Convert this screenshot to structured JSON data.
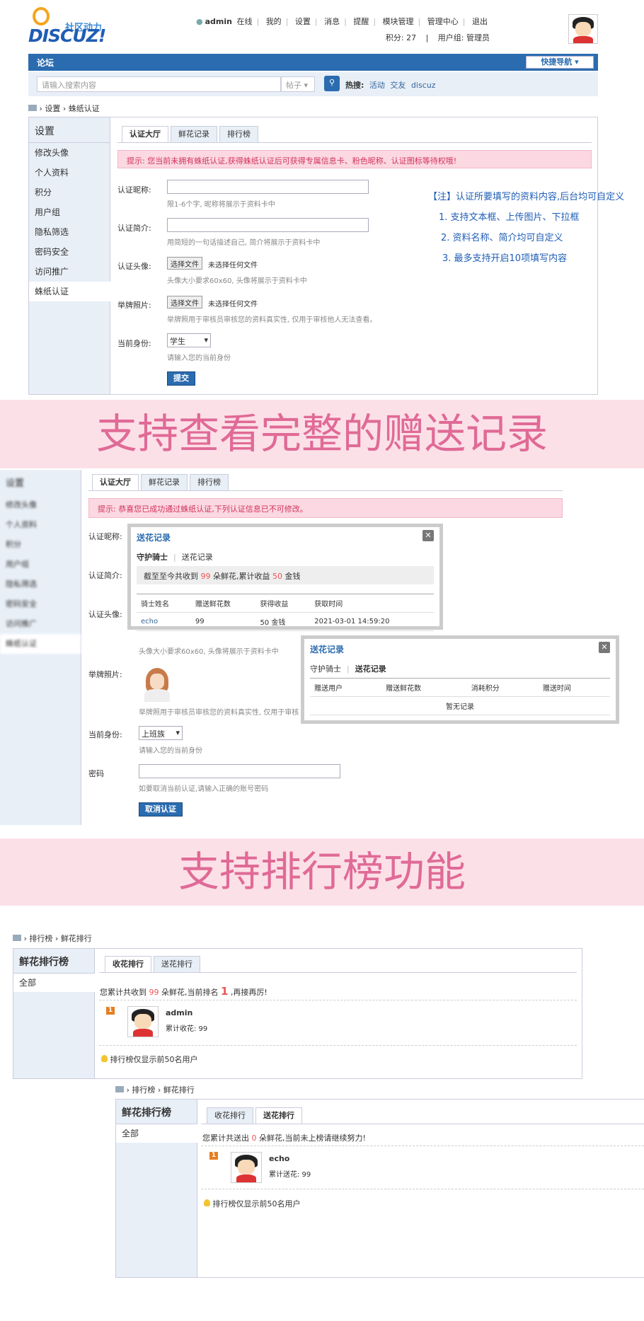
{
  "header": {
    "logo_text": "DISCUZ!",
    "logo_tag": "社区动力",
    "username": "admin",
    "online": "在线",
    "mine": "我的",
    "settings": "设置",
    "messages": "消息",
    "reminder": "提醒",
    "module_manage": "模块管理",
    "admin_center": "管理中心",
    "logout": "退出",
    "points": "积分: 27",
    "usergroup": "用户组: 管理员"
  },
  "navbar": {
    "title": "论坛",
    "quick_nav": "快捷导航"
  },
  "search": {
    "placeholder": "请输入搜索内容",
    "type": "帖子",
    "hot_label": "热搜:",
    "hot": [
      "活动",
      "交友",
      "discuz"
    ]
  },
  "crumb1": {
    "items": [
      "设置",
      "蛛纸认证"
    ]
  },
  "sidebar": {
    "title": "设置",
    "items": [
      "修改头像",
      "个人资料",
      "积分",
      "用户组",
      "隐私筛选",
      "密码安全",
      "访问推广",
      "蛛纸认证"
    ]
  },
  "tabs": [
    "认证大厅",
    "鲜花记录",
    "排行榜"
  ],
  "form1": {
    "notice": "提示: 您当前未拥有蛛纸认证,获得蛛纸认证后可获得专属信息卡、粉色昵称、认证图标等待权哦!",
    "nickname_label": "认证昵称:",
    "nickname_hint": "限1-6个字, 昵称将展示于资料卡中",
    "intro_label": "认证简介:",
    "intro_hint": "用简短的一句话描述自己, 简介将展示于资料卡中",
    "avatar_label": "认证头像:",
    "file_btn": "选择文件",
    "file_none": "未选择任何文件",
    "avatar_hint": "头像大小要求60x60, 头像将展示于资料卡中",
    "photo_label": "举牌照片:",
    "photo_hint": "举牌照用于审核员审核您的资料真实性, 仅用于审核他人无法查看。",
    "identity_label": "当前身份:",
    "identity_value": "学生",
    "identity_hint": "请输入您的当前身份",
    "submit": "提交"
  },
  "notes": [
    "【注】认证所要填写的资料内容,后台均可自定义",
    "1. 支持文本框、上传图片、下拉框",
    "2. 资料名称、简介均可自定义",
    "3. 最多支持开启10项填写内容"
  ],
  "banner1": "支持查看完整的赠送记录",
  "form2": {
    "sidebar_blur": [
      "设置",
      "修改头像",
      "个人资料",
      "积分",
      "用户组",
      "隐私筛选",
      "密码安全",
      "访问推广",
      "蛛纸认证"
    ],
    "notice": "提示: 恭喜您已成功通过蛛纸认证,下列认证信息已不可修改。",
    "nickname_label": "认证昵称:",
    "intro_label": "认证简介:",
    "avatar_label": "认证头像:",
    "avatar_hint": "头像大小要求60x60, 头像将展示于资料卡中",
    "photo_label": "举牌照片:",
    "photo_hint": "举牌照用于审核员审核您的资料真实性, 仅用于审核",
    "identity_label": "当前身份:",
    "identity_value": "上班族",
    "identity_hint": "请输入您的当前身份",
    "password_label": "密码",
    "password_hint": "如要取消当前认证,请输入正确的账号密码",
    "cancel": "取消认证"
  },
  "popup1": {
    "title": "送花记录",
    "tab_a": "守护骑士",
    "tab_b": "送花记录",
    "summary": [
      "截至至今共收到 ",
      "99",
      " 朵鲜花,累计收益 ",
      "50",
      " 金钱"
    ],
    "headers": [
      "骑士姓名",
      "赠送鲜花数",
      "获得收益",
      "获取时间"
    ],
    "rows": [
      [
        "echo",
        "99",
        "50 金钱",
        "2021-03-01 14:59:20"
      ]
    ]
  },
  "popup2": {
    "title": "送花记录",
    "tab_a": "守护骑士",
    "tab_b": "送花记录",
    "headers": [
      "赠送用户",
      "赠送鲜花数",
      "消耗积分",
      "赠送时间"
    ],
    "empty": "暂无记录"
  },
  "banner2": "支持排行榜功能",
  "rank1": {
    "crumb": [
      "排行榜",
      "鲜花排行"
    ],
    "title": "鲜花排行榜",
    "side_item": "全部",
    "tabs": [
      "收花排行",
      "送花排行"
    ],
    "summary": [
      "您累计共收到 ",
      "99",
      " 朵鲜花,当前排名 ",
      "1",
      " ,再接再厉!"
    ],
    "rank_no": "1",
    "user": "admin",
    "stat": "累计收花: 99",
    "footer": "排行榜仅显示前50名用户"
  },
  "rank2": {
    "crumb": [
      "排行榜",
      "鲜花排行"
    ],
    "title": "鲜花排行榜",
    "side_item": "全部",
    "tabs": [
      "收花排行",
      "送花排行"
    ],
    "summary": [
      "您累计共送出 ",
      "0",
      " 朵鲜花,当前未上榜请继续努力!"
    ],
    "rank_no": "1",
    "user": "echo",
    "stat": "累计送花: 99",
    "footer": "排行榜仅显示前50名用户"
  },
  "colors": {
    "brand_blue": "#2b6cb0",
    "banner_bg": "#fce0e8",
    "banner_text": "#e06a96",
    "notice_text": "#d2335b"
  }
}
